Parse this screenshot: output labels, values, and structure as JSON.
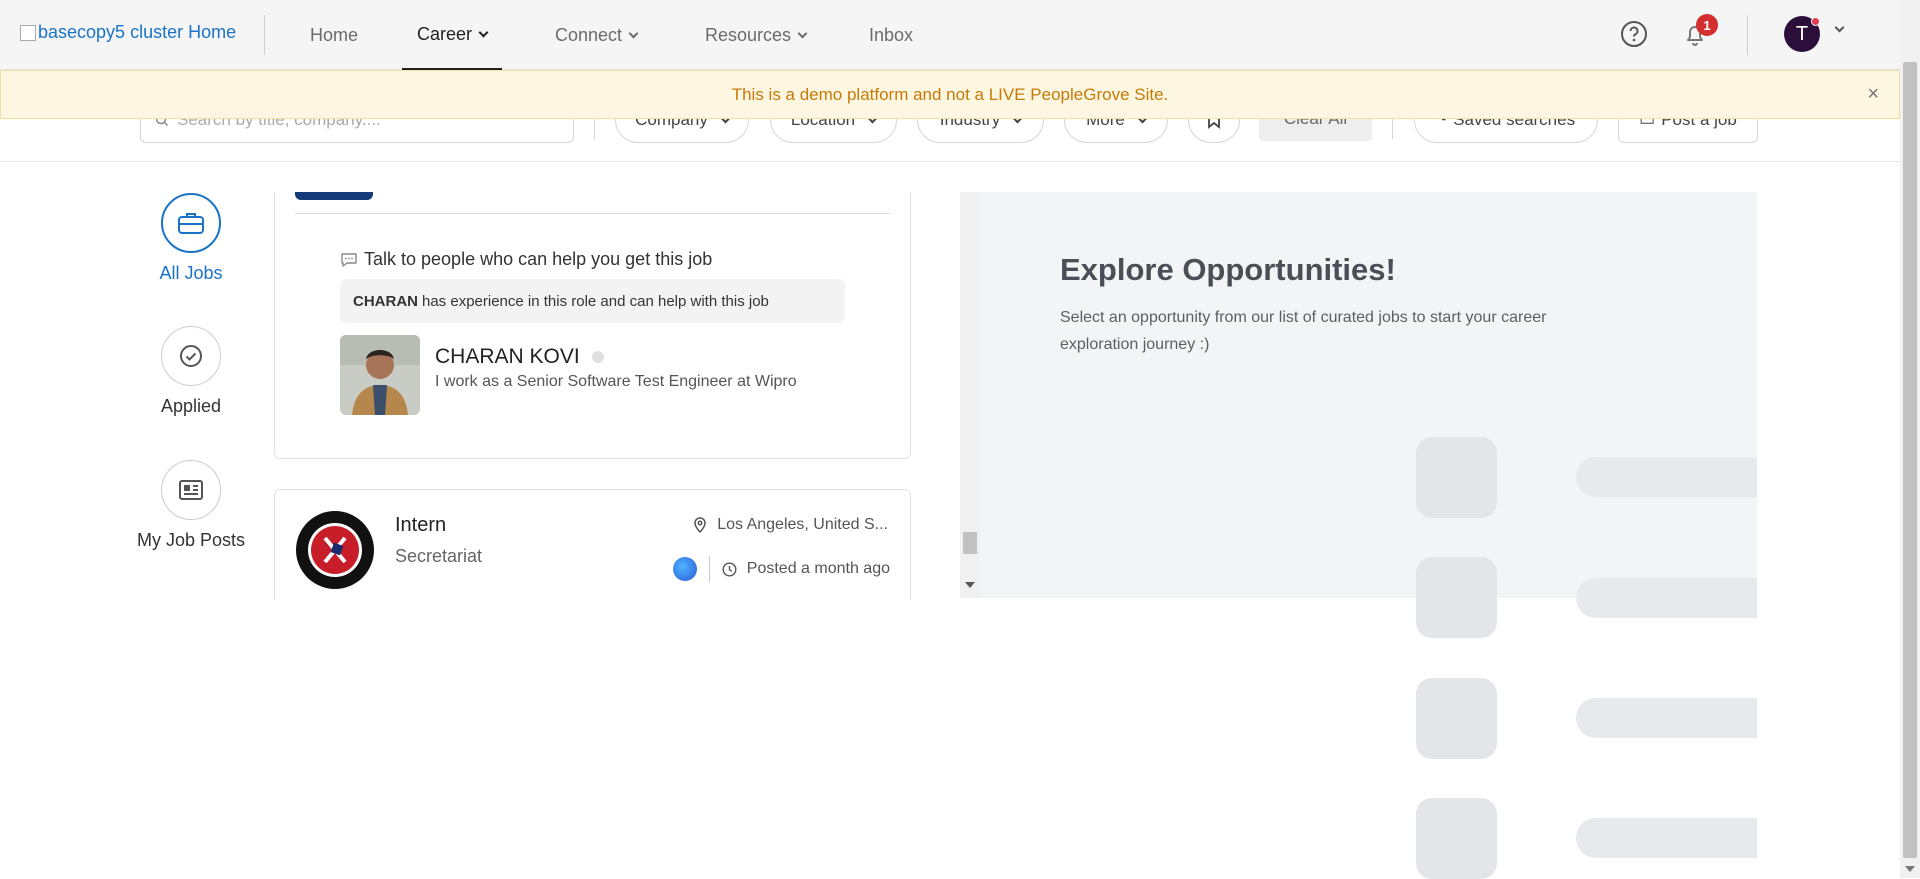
{
  "header": {
    "logo_alt": "basecopy5 cluster Home",
    "nav": {
      "home": "Home",
      "career": "Career",
      "connect": "Connect",
      "resources": "Resources",
      "inbox": "Inbox"
    },
    "notification_count": "1",
    "user_initial": "T"
  },
  "banner": {
    "text": "This is a demo platform and not a LIVE PeopleGrove Site.",
    "close": "×"
  },
  "filters": {
    "search_placeholder": "Search by title, company....",
    "company": "Company",
    "location": "Location",
    "industry": "Industry",
    "more": "More",
    "clear_all": "Clear All",
    "saved_searches": "Saved searches",
    "post_job": "Post a job"
  },
  "sidenav": {
    "all_jobs": "All Jobs",
    "applied": "Applied",
    "my_job_posts": "My Job Posts"
  },
  "job_card_1": {
    "talk_heading": "Talk to people who can help you get this job",
    "experience_name": "CHARAN",
    "experience_text": "has experience in this role and can help with this job",
    "person_name": "CHARAN KOVI",
    "person_title": "I work as a Senior Software Test Engineer at Wipro"
  },
  "job_card_2": {
    "title": "Intern",
    "company": "Secretariat",
    "location": "Los Angeles, United S...",
    "posted": "Posted a month ago"
  },
  "detail": {
    "title": "Explore Opportunities!",
    "description": "Select an opportunity from our list of curated jobs to start your career exploration journey :)"
  },
  "colors": {
    "accent": "#1a73c8",
    "banner_bg": "#fdf6e0",
    "banner_text": "#c77a0a",
    "badge": "#d32f2f"
  }
}
